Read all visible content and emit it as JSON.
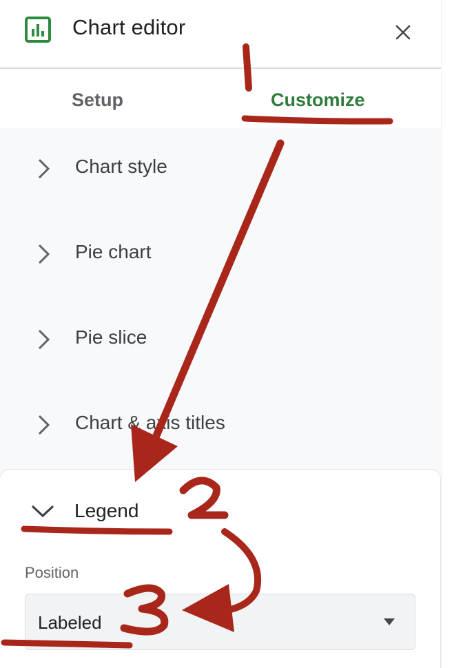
{
  "header": {
    "title": "Chart editor",
    "icon": "bar-chart-icon",
    "close_icon": "close-icon"
  },
  "tabs": [
    {
      "label": "Setup",
      "active": false
    },
    {
      "label": "Customize",
      "active": true
    }
  ],
  "sections": [
    {
      "label": "Chart style",
      "expanded": false
    },
    {
      "label": "Pie chart",
      "expanded": false
    },
    {
      "label": "Pie slice",
      "expanded": false
    },
    {
      "label": "Chart & axis titles",
      "expanded": false
    }
  ],
  "legend": {
    "label": "Legend",
    "expanded": true,
    "position_label": "Position",
    "position_value": "Labeled"
  },
  "annotations": {
    "step1": "1",
    "step2": "2",
    "step3": "3"
  },
  "colors": {
    "accent_green": "#2d7d3a",
    "annotation_red": "#a8261a"
  }
}
